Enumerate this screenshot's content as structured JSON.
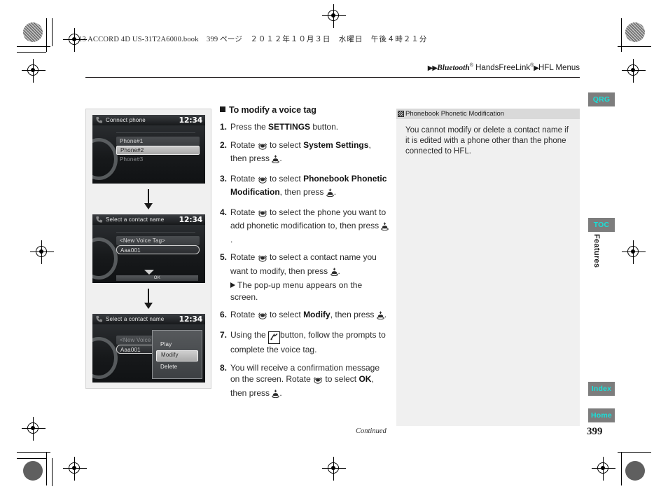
{
  "print_header": {
    "book_line": "13 ACCORD 4D US-31T2A6000.book",
    "page_marker": "399 ページ",
    "date_line": "２０１２年１０月３日　水曜日　午後４時２１分"
  },
  "breadcrumb": {
    "arrows": "▶▶",
    "part1": "Bluetooth",
    "sup1": "®",
    "part2": "HandsFreeLink",
    "sup2": "®",
    "arrow_mid": "▶",
    "part3": "HFL Menus"
  },
  "section": {
    "heading": "To modify a voice tag",
    "steps": [
      {
        "num": "1.",
        "segments": [
          {
            "t": "Press the ",
            "b": false
          },
          {
            "t": "SETTINGS",
            "b": true
          },
          {
            "t": " button.",
            "b": false
          }
        ]
      },
      {
        "num": "2.",
        "segments": [
          {
            "t": "Rotate ",
            "b": false
          },
          {
            "icon": "rotary-knob-icon"
          },
          {
            "t": " to select ",
            "b": false
          },
          {
            "t": "System Settings",
            "b": true
          },
          {
            "t": ", then press ",
            "b": false
          },
          {
            "icon": "press-knob-icon"
          },
          {
            "t": ".",
            "b": false
          }
        ]
      },
      {
        "num": "3.",
        "segments": [
          {
            "t": "Rotate ",
            "b": false
          },
          {
            "icon": "rotary-knob-icon"
          },
          {
            "t": " to select ",
            "b": false
          },
          {
            "t": "Phonebook Phonetic Modification",
            "b": true
          },
          {
            "t": ", then press ",
            "b": false
          },
          {
            "icon": "press-knob-icon"
          },
          {
            "t": ".",
            "b": false
          }
        ]
      },
      {
        "num": "4.",
        "segments": [
          {
            "t": "Rotate ",
            "b": false
          },
          {
            "icon": "rotary-knob-icon"
          },
          {
            "t": " to select the phone you want to add phonetic modification to, then press ",
            "b": false
          },
          {
            "icon": "press-knob-icon"
          },
          {
            "t": ".",
            "b": false
          }
        ]
      },
      {
        "num": "5.",
        "segments": [
          {
            "t": "Rotate ",
            "b": false
          },
          {
            "icon": "rotary-knob-icon"
          },
          {
            "t": " to select a contact name you want to modify, then press ",
            "b": false
          },
          {
            "icon": "press-knob-icon"
          },
          {
            "t": ".",
            "b": false
          }
        ],
        "subnote": "The pop-up menu appears on the screen."
      },
      {
        "num": "6.",
        "segments": [
          {
            "t": "Rotate ",
            "b": false
          },
          {
            "icon": "rotary-knob-icon"
          },
          {
            "t": " to select ",
            "b": false
          },
          {
            "t": "Modify",
            "b": true
          },
          {
            "t": ", then press ",
            "b": false
          },
          {
            "icon": "press-knob-icon"
          },
          {
            "t": ".",
            "b": false
          }
        ]
      },
      {
        "num": "7.",
        "segments": [
          {
            "t": "Using the ",
            "b": false
          },
          {
            "icon": "talk-button-icon"
          },
          {
            "t": "button, follow the prompts to complete the voice tag.",
            "b": false
          }
        ]
      },
      {
        "num": "8.",
        "segments": [
          {
            "t": "You will receive a confirmation message on the screen. Rotate ",
            "b": false
          },
          {
            "icon": "rotary-knob-icon"
          },
          {
            "t": " to select ",
            "b": false
          },
          {
            "t": "OK",
            "b": true
          },
          {
            "t": ", then press ",
            "b": false
          },
          {
            "icon": "press-knob-icon"
          },
          {
            "t": ".",
            "b": false
          }
        ]
      }
    ],
    "continued_label": "Continued"
  },
  "note": {
    "title": "Phonebook Phonetic Modification",
    "body": "You cannot modify or delete a contact name if it is edited with a phone other than the phone connected to HFL."
  },
  "screens": [
    {
      "title": "Connect phone",
      "clock": "12:34",
      "items": [
        {
          "label": "Phone#1",
          "state": "band"
        },
        {
          "label": "Phone#2",
          "state": "sel"
        },
        {
          "label": "Phone#3",
          "state": "dim"
        }
      ],
      "has_separator": true,
      "down_arrow": false,
      "ok_label": "",
      "popup": null
    },
    {
      "title": "Select a contact name",
      "clock": "12:34",
      "items": [
        {
          "label": "<New Voice Tag>",
          "state": "band"
        },
        {
          "label": "Aaa001",
          "state": "outline"
        }
      ],
      "has_separator": true,
      "down_arrow": true,
      "ok_label": "OK",
      "popup": null
    },
    {
      "title": "Select a contact name",
      "clock": "12:34",
      "items": [
        {
          "label": "<New Voice Tag>",
          "state": "dimband"
        },
        {
          "label": "Aaa001",
          "state": "outline"
        }
      ],
      "has_separator": false,
      "down_arrow": false,
      "ok_label": "",
      "popup": {
        "items": [
          {
            "label": "Play",
            "selected": false
          },
          {
            "label": "Modify",
            "selected": true
          },
          {
            "label": "Delete",
            "selected": false
          }
        ]
      }
    }
  ],
  "tabs": {
    "qrg": "QRG",
    "toc": "TOC",
    "index": "Index",
    "home": "Home",
    "features": "Features"
  },
  "page_number": "399",
  "colors": {
    "tab_bg": "#7d7d7d",
    "tab_text": "#19e0d8",
    "panel_bg": "#f0f0f0",
    "note_head_bg": "#d9d9d9"
  }
}
